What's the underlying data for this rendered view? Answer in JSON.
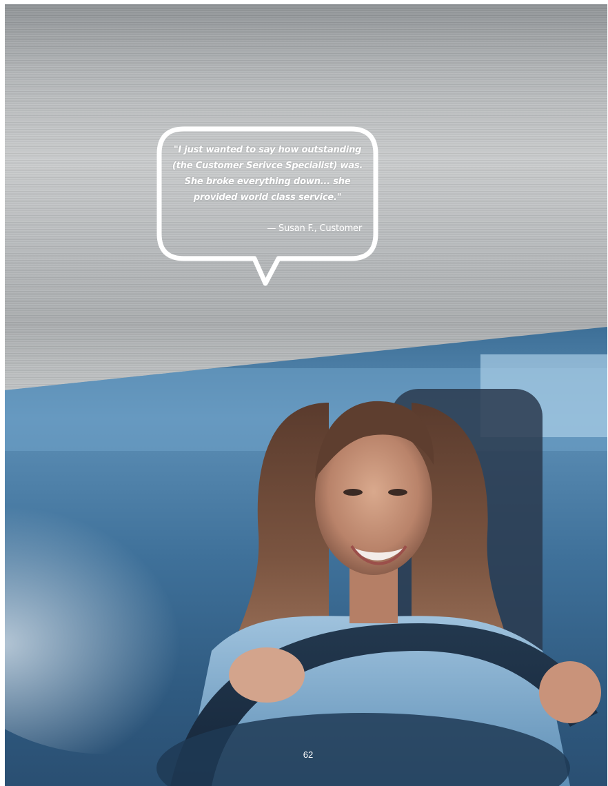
{
  "testimonial": {
    "quote_lines": [
      "\"I just wanted to say how outstanding",
      "(the Customer Serivce Specialist) was.",
      "She broke everything down... she",
      "provided world class service.\""
    ],
    "attribution": "— Susan F., Customer"
  },
  "page_number": "62",
  "colors": {
    "bubble_stroke": "#ffffff",
    "metal_base": "#b7babc",
    "photo_base": "#3d6f97"
  }
}
